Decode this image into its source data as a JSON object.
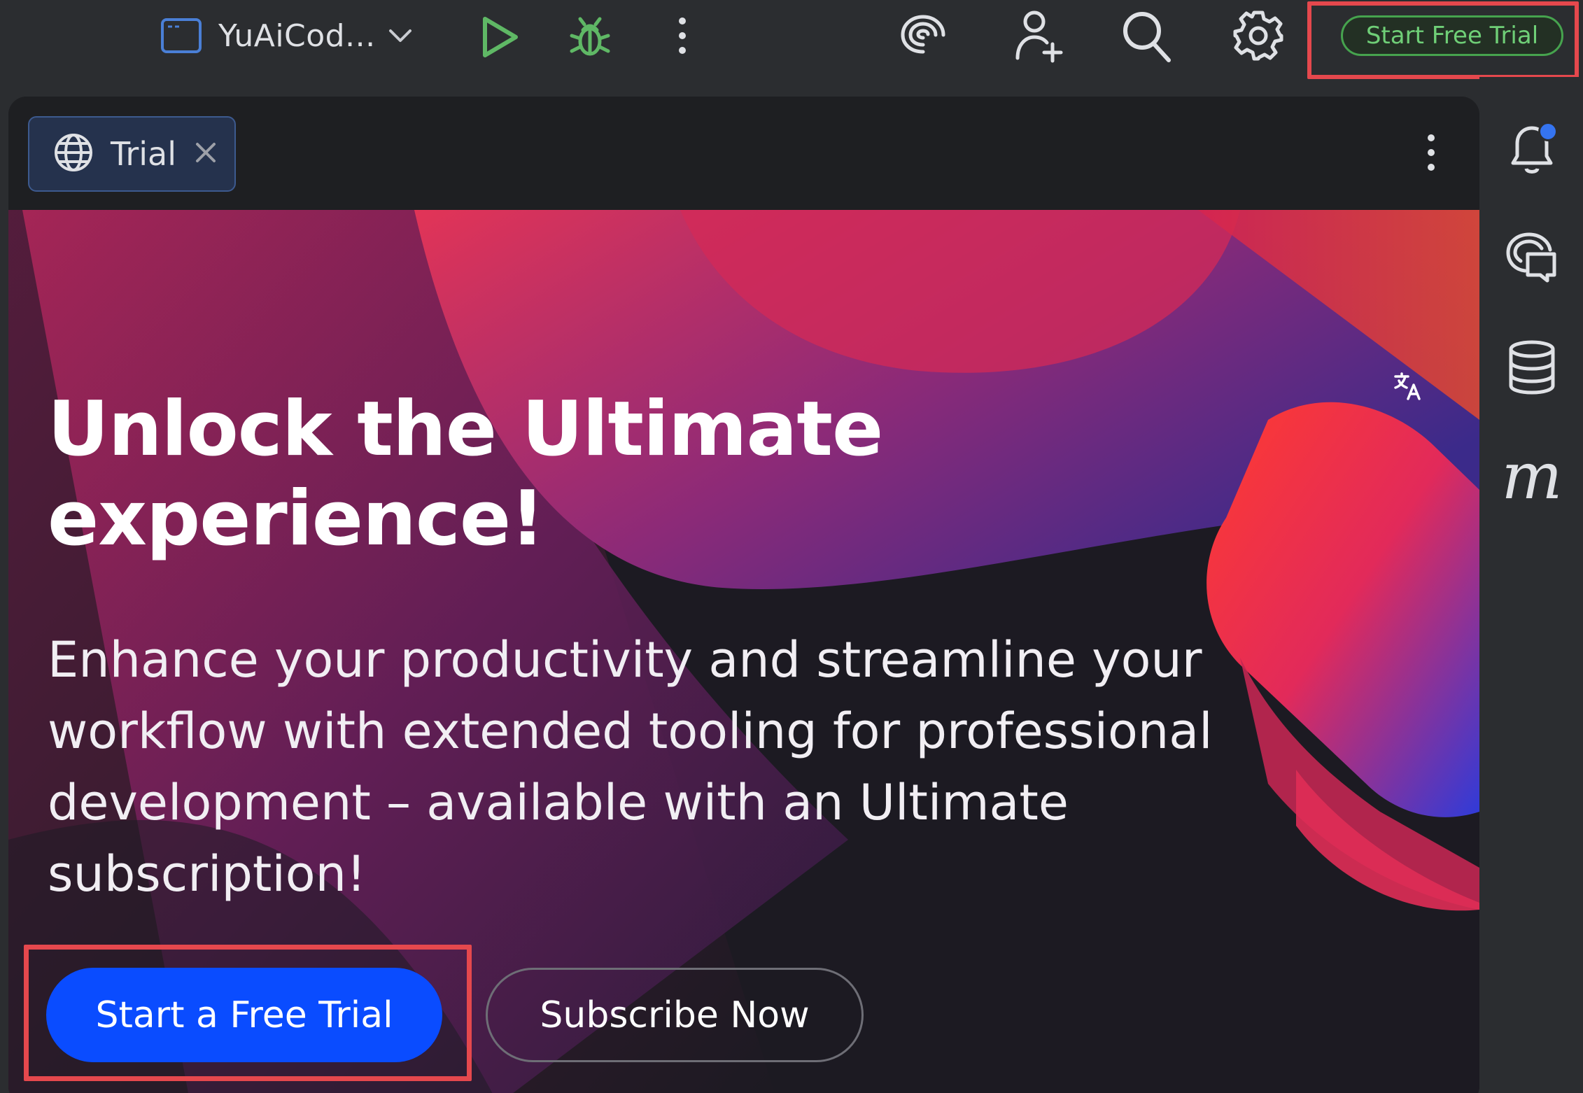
{
  "toolbar": {
    "project_name": "YuAiCod...",
    "project_icon": "window-icon",
    "icons": [
      "chevron-down-icon",
      "run-icon",
      "debug-icon",
      "more-vertical-icon",
      "ai-assistant-icon",
      "add-user-icon",
      "search-icon",
      "settings-icon"
    ],
    "start_trial_label": "Start Free Trial",
    "accent_green": "#46a34e"
  },
  "tab": {
    "label": "Trial",
    "icon": "globe-icon"
  },
  "hero": {
    "headline": "Unlock the Ultimate experience!",
    "subtext": "Enhance your productivity and streamline your workflow with extended tooling for professional development – available with an Ultimate subscription!",
    "primary_button": "Start a Free Trial",
    "secondary_button": "Subscribe Now",
    "primary_color": "#0a4cff"
  },
  "sidebar": {
    "icons": [
      "notifications-icon",
      "ai-chat-icon",
      "database-icon",
      "m-plugin-icon"
    ],
    "m_label": "m"
  },
  "highlight_color": "#e5484d"
}
